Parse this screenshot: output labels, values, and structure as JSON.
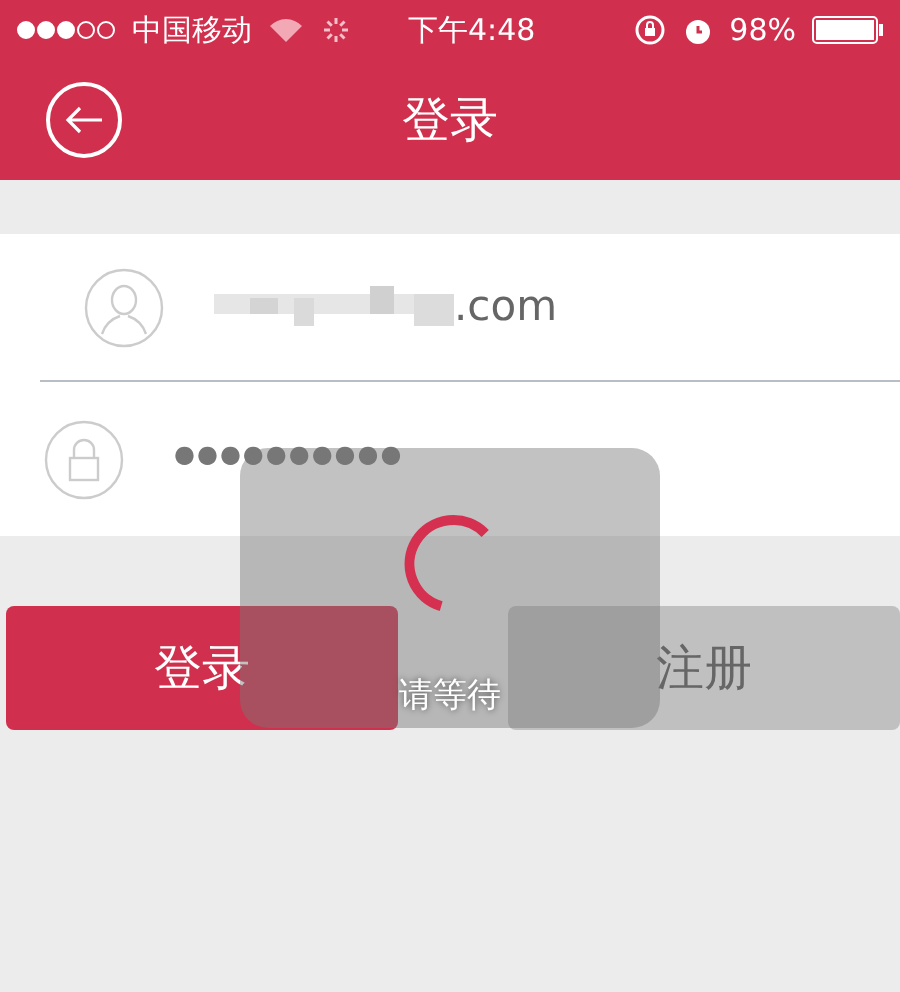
{
  "status_bar": {
    "carrier": "中国移动",
    "time": "下午4:48",
    "battery": "98%"
  },
  "nav_bar": {
    "title": "登录"
  },
  "form": {
    "email_suffix": ".com",
    "password_mask": "●●●●●●●●●●"
  },
  "buttons": [
    {
      "label": "登录",
      "kind": "primary"
    },
    {
      "label": "注册",
      "kind": "secondary"
    }
  ],
  "loading_hud": {
    "label": "请等待"
  }
}
